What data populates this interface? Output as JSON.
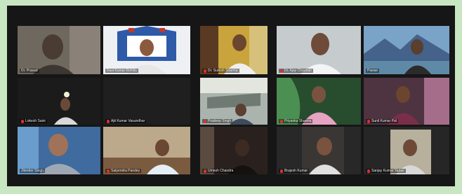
{
  "meeting": {
    "active_speaker_color": "#d9dc3a",
    "muted_mic_color": "#e0302b",
    "background_color": "#c8e6c2"
  },
  "participants": [
    {
      "name": "Dr. Prasad",
      "muted": false
    },
    {
      "name": "Ravi Kumar Rohilla",
      "muted": false
    },
    {
      "name": "Dr. Suresh Sharma",
      "muted": true
    },
    {
      "name": "Dr. Ajay Chauhan",
      "muted": true
    },
    {
      "name": "Pawan",
      "muted": false
    },
    {
      "name": "Lokesh Saini",
      "muted": true
    },
    {
      "name": "Ajit Kumar Vasundhar",
      "muted": true
    },
    {
      "name": "Pradeep Singh",
      "muted": true
    },
    {
      "name": "Priyanka Sharma",
      "muted": true
    },
    {
      "name": "Sunil Kumar Pal",
      "muted": true
    },
    {
      "name": "Jitender Singh",
      "muted": false
    },
    {
      "name": "Satyendra Pandey",
      "muted": true
    },
    {
      "name": "Umesh Chandra",
      "muted": true
    },
    {
      "name": "Brajesh Kumar",
      "muted": true
    },
    {
      "name": "Sanjay Kumar Yadav",
      "muted": true
    }
  ]
}
